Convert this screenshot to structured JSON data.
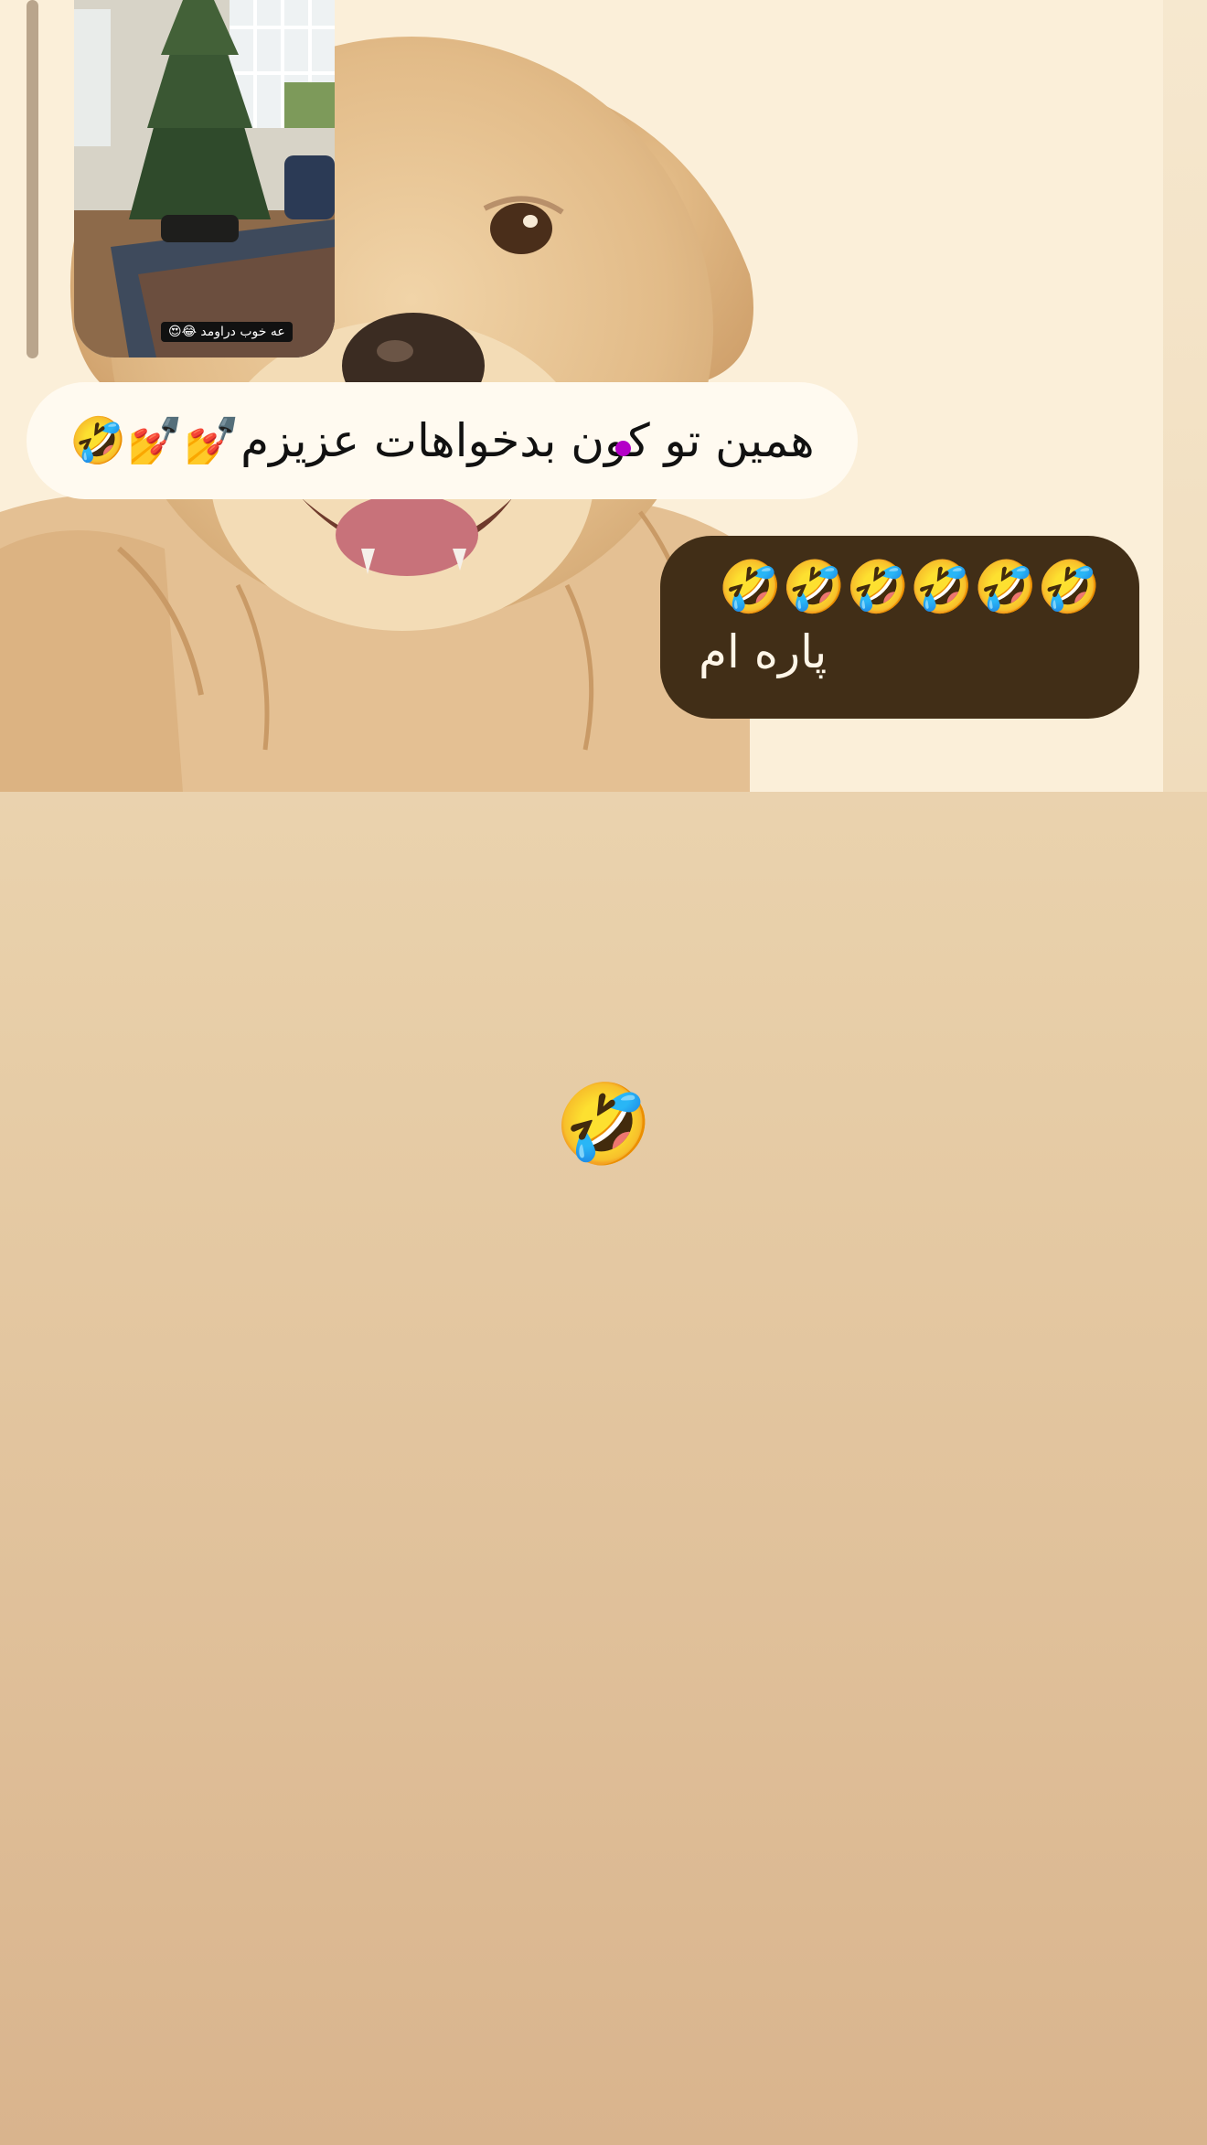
{
  "chat": {
    "media_message": {
      "caption": "عه خوب دراومد 😂😍"
    },
    "incoming_message": {
      "text": "همین تو کون بدخواهات عزیزم💅💅🤣"
    },
    "outgoing_message": {
      "emoji_line": "🤣🤣🤣🤣🤣🤣",
      "text": "پاره ام"
    },
    "emoji_message": {
      "text": "🤣"
    }
  },
  "colors": {
    "incoming_bubble": "#fffaf0",
    "outgoing_bubble": "#412e17",
    "reaction_dot": "#b400c8",
    "background_top": "#f3e2c4",
    "background_bottom": "#d9b48d"
  }
}
